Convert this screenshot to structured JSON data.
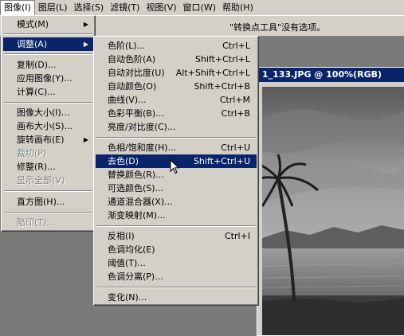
{
  "menubar": {
    "items": [
      "图像(I)",
      "图层(L)",
      "选择(S)",
      "滤镜(T)",
      "视图(V)",
      "窗口(W)",
      "帮助(H)"
    ]
  },
  "options": {
    "hint": "\"转换点工具\"没有选项。"
  },
  "document": {
    "title": "1_133.JPG @ 100%(RGB)"
  },
  "image_menu": {
    "mode": "模式(M)",
    "adjust": "调整(A)",
    "duplicate": "复制(D)...",
    "apply_image": "应用图像(Y)...",
    "calculations": "计算(C)...",
    "image_size": "图像大小(I)...",
    "canvas_size": "画布大小(S)...",
    "rotate_canvas": "旋转画布(E)",
    "crop": "裁切(P)",
    "trim": "修整(R)...",
    "reveal_all": "显示全部(V)",
    "histogram": "直方图(H)...",
    "trap": "陷印(T)..."
  },
  "adjust_menu": {
    "levels": {
      "label": "色阶(L)...",
      "shortcut": "Ctrl+L"
    },
    "auto_levels": {
      "label": "自动色阶(A)",
      "shortcut": "Shift+Ctrl+L"
    },
    "auto_contrast": {
      "label": "自动对比度(U)",
      "shortcut": "Alt+Shift+Ctrl+L"
    },
    "auto_color": {
      "label": "自动颜色(O)",
      "shortcut": "Shift+Ctrl+B"
    },
    "curves": {
      "label": "曲线(V)...",
      "shortcut": "Ctrl+M"
    },
    "color_balance": {
      "label": "色彩平衡(B)...",
      "shortcut": "Ctrl+B"
    },
    "brightness_contrast": {
      "label": "亮度/对比度(C)...",
      "shortcut": ""
    },
    "hue_saturation": {
      "label": "色相/饱和度(H)...",
      "shortcut": "Ctrl+U"
    },
    "desaturate": {
      "label": "去色(D)",
      "shortcut": "Shift+Ctrl+U"
    },
    "replace_color": {
      "label": "替换颜色(R)...",
      "shortcut": ""
    },
    "selective_color": {
      "label": "可选颜色(S)...",
      "shortcut": ""
    },
    "channel_mixer": {
      "label": "通道混合器(X)...",
      "shortcut": ""
    },
    "gradient_map": {
      "label": "渐变映射(M)...",
      "shortcut": ""
    },
    "invert": {
      "label": "反相(I)",
      "shortcut": "Ctrl+I"
    },
    "equalize": {
      "label": "色调均化(E)",
      "shortcut": ""
    },
    "threshold": {
      "label": "阈值(T)...",
      "shortcut": ""
    },
    "posterize": {
      "label": "色调分离(P)...",
      "shortcut": ""
    },
    "variations": {
      "label": "变化(N)...",
      "shortcut": ""
    }
  },
  "colors": {
    "highlight": "#0a246a",
    "menu_bg": "#d4d0c8"
  }
}
